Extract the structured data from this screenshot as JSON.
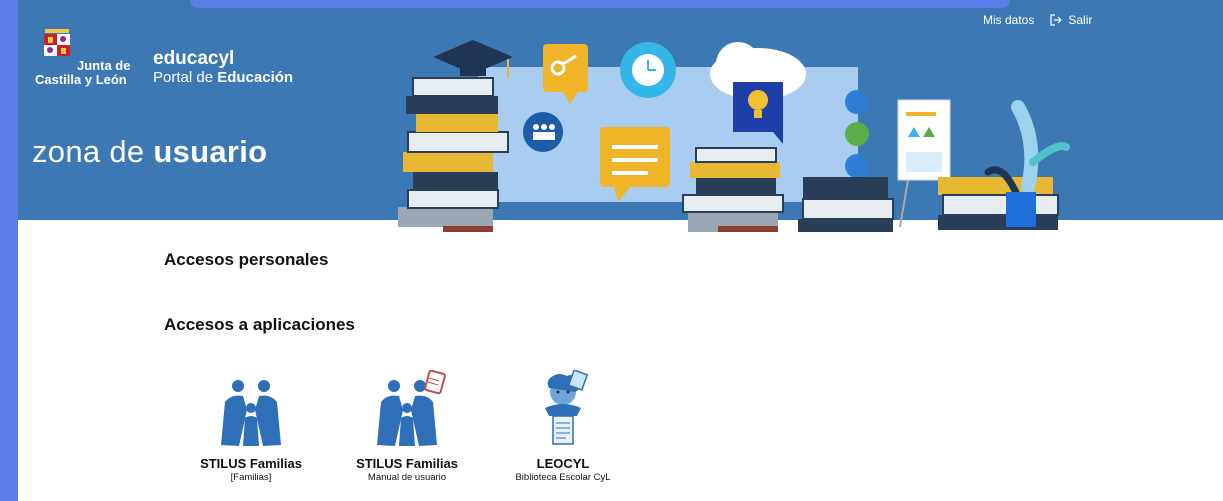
{
  "header": {
    "jcyl_line1": "Junta de",
    "jcyl_line2": "Castilla y León",
    "portal_name": "educacyl",
    "portal_sub_prefix": "Portal de ",
    "portal_sub_bold": "Educación",
    "zone_prefix": "zona de ",
    "zone_bold": "usuario",
    "nav": {
      "mis_datos": "Mis datos",
      "salir": "Salir"
    }
  },
  "sections": {
    "personal": "Accesos personales",
    "apps": "Accesos a aplicaciones"
  },
  "apps": [
    {
      "title": "STILUS Familias",
      "subtitle": "[Familias]",
      "icon": "family-icon"
    },
    {
      "title": "STILUS Familias",
      "subtitle": "Manual de usuario",
      "icon": "family-manual-icon"
    },
    {
      "title": "LEOCYL",
      "subtitle": "Biblioteca Escolar CyL",
      "icon": "reader-icon"
    }
  ],
  "colors": {
    "banner": "#3c78b4",
    "frame": "#5a7fe8",
    "icon_blue": "#2e6fb8"
  }
}
